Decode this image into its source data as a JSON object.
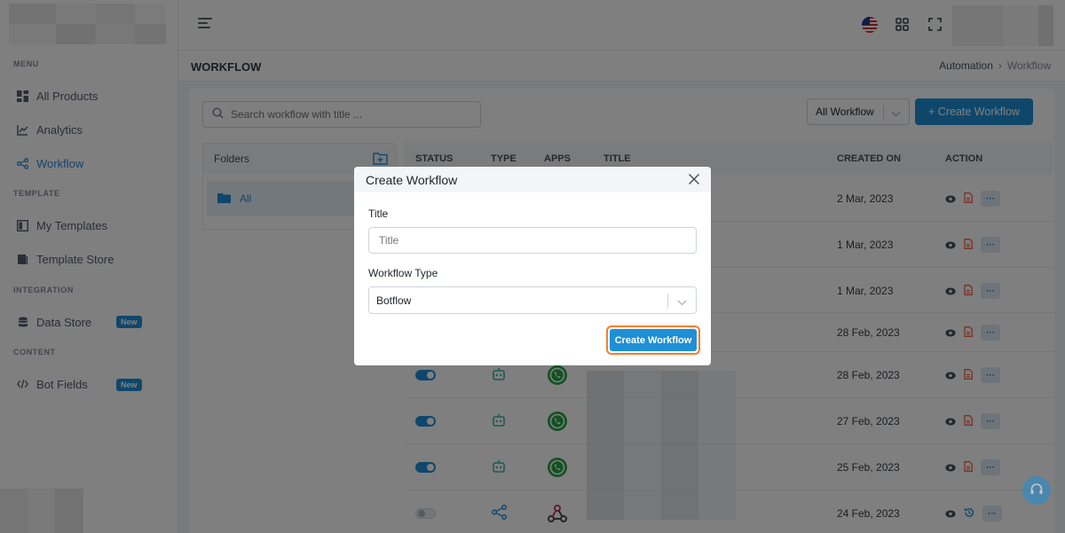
{
  "sidebar": {
    "sections": {
      "menu": "MENU",
      "template": "TEMPLATE",
      "integration": "INTEGRATION",
      "content": "CONTENT"
    },
    "items": [
      {
        "label": "All Products",
        "icon": "dashboard-icon"
      },
      {
        "label": "Analytics",
        "icon": "chart-line-icon"
      },
      {
        "label": "Workflow",
        "icon": "share-nodes-icon",
        "active": true
      },
      {
        "label": "My Templates",
        "icon": "template-icon"
      },
      {
        "label": "Template Store",
        "icon": "book-icon"
      },
      {
        "label": "Data Store",
        "icon": "database-icon",
        "badge": "New"
      },
      {
        "label": "Bot Fields",
        "icon": "code-icon",
        "badge": "New"
      }
    ]
  },
  "page": {
    "title": "WORKFLOW",
    "breadcrumb": [
      "Automation",
      "Workflow"
    ]
  },
  "toolbar": {
    "search_placeholder": "Search workflow with title ...",
    "filter_value": "All Workflow",
    "create_label": "+ Create Workflow"
  },
  "folders": {
    "header": "Folders",
    "items": [
      "All"
    ]
  },
  "table": {
    "headers": [
      "STATUS",
      "TYPE",
      "APPS",
      "TITLE",
      "CREATED ON",
      "ACTION"
    ],
    "rows": [
      {
        "created_on": "2 Mar, 2023"
      },
      {
        "created_on": "1 Mar, 2023"
      },
      {
        "created_on": "1 Mar, 2023"
      },
      {
        "created_on": "28 Feb, 2023"
      },
      {
        "created_on": "28 Feb, 2023",
        "status": "on",
        "type": "bot",
        "app": "whatsapp"
      },
      {
        "created_on": "27 Feb, 2023",
        "status": "on",
        "type": "bot",
        "app": "whatsapp"
      },
      {
        "created_on": "25 Feb, 2023",
        "status": "on",
        "type": "bot",
        "app": "whatsapp"
      },
      {
        "created_on": "24 Feb, 2023",
        "status": "off",
        "type": "flow",
        "app": "webhook"
      }
    ]
  },
  "modal": {
    "title": "Create Workflow",
    "title_label": "Title",
    "title_placeholder": "Title",
    "type_label": "Workflow Type",
    "type_value": "Botflow",
    "submit_label": "Create Workflow"
  },
  "colors": {
    "primary": "#1f8fd6",
    "whatsapp": "#25a244",
    "bot": "#3bb3a0",
    "danger": "#f06548",
    "highlight": "#f47e2c"
  }
}
